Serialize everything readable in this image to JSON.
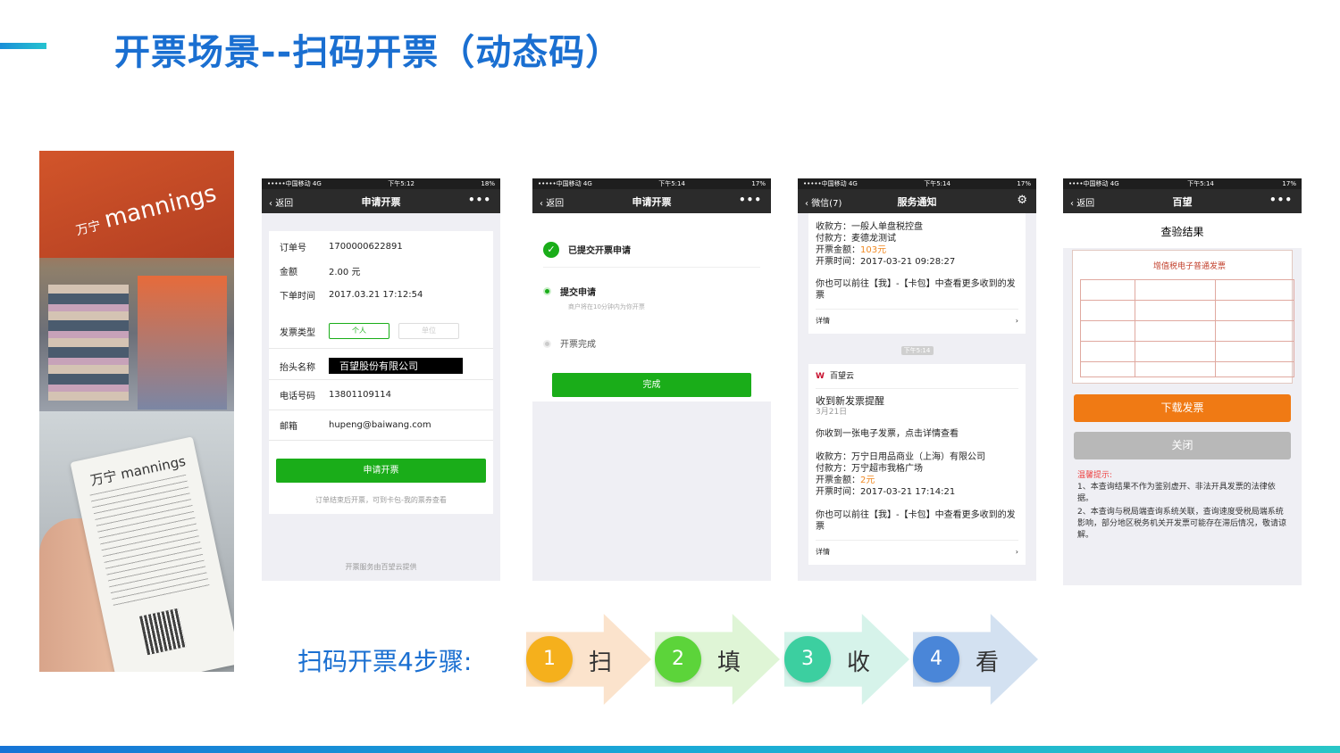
{
  "slide": {
    "title": "开票场景--扫码开票（动态码）",
    "steps_label": "扫码开票4步骤:",
    "steps": [
      {
        "num": "1",
        "word": "扫",
        "circle_color": "#f5b01c",
        "arrow_color": "#fbe3cc"
      },
      {
        "num": "2",
        "word": "填",
        "circle_color": "#5cd43a",
        "arrow_color": "#dff5d6"
      },
      {
        "num": "3",
        "word": "收",
        "circle_color": "#3ccfa0",
        "arrow_color": "#d6f3ea"
      },
      {
        "num": "4",
        "word": "看",
        "circle_color": "#4a86d8",
        "arrow_color": "#d3e1f1"
      }
    ]
  },
  "photos": {
    "store_brand": "mannings",
    "store_brand_cn": "万宁",
    "receipt_brand": "万宁 mannings"
  },
  "screen1": {
    "status": {
      "carrier": "•••••中国移动  4G",
      "time": "下午5:12",
      "battery": "18%"
    },
    "nav": {
      "back": "返回",
      "title": "申请开票",
      "more": "•••"
    },
    "order_label": "订单号",
    "order_value": "1700000622891",
    "amount_label": "金额",
    "amount_value": "2.00 元",
    "time_label": "下单时间",
    "time_value": "2017.03.21 17:12:54",
    "type_label": "发票类型",
    "type_personal": "个人",
    "type_company": "单位",
    "header_label": "抬头名称",
    "header_value": "百望股份有限公司",
    "phone_label": "电话号码",
    "phone_value": "13801109114",
    "email_label": "邮箱",
    "email_value": "hupeng@baiwang.com",
    "submit": "申请开票",
    "hint": "订单结束后开票，可到卡包-我的票券查看",
    "footer": "开票服务由百望云提供"
  },
  "screen2": {
    "status": {
      "carrier": "•••••中国移动  4G",
      "time": "下午5:14",
      "battery": "17%"
    },
    "nav": {
      "back": "返回",
      "title": "申请开票",
      "more": "•••"
    },
    "submitted": "已提交开票申请",
    "step1": "提交申请",
    "step1_hint": "商户将在10分钟内为你开票",
    "step2": "开票完成",
    "done": "完成"
  },
  "screen3": {
    "status": {
      "carrier": "•••••中国移动  4G",
      "time": "下午5:14",
      "battery": "17%"
    },
    "nav": {
      "back": "微信(7)",
      "title": "服务通知"
    },
    "msg1": {
      "payee": "收款方：一般人单盘税控盘",
      "payer": "付款方：麦德龙测试",
      "amount_prefix": "开票金额：",
      "amount": "103元",
      "time": "开票时间：2017-03-21 09:28:27",
      "note": "你也可以前往【我】-【卡包】中查看更多收到的发票",
      "detail": "详情"
    },
    "time_chip": "下午5:14",
    "msg2": {
      "sender": "百望云",
      "title": "收到新发票提醒",
      "date": "3月21日",
      "body": "你收到一张电子发票，点击详情查看",
      "payee": "收款方：万宁日用品商业（上海）有限公司",
      "payer": "付款方：万宁超市我格广场",
      "amount_prefix": "开票金额：",
      "amount": "2元",
      "time": "开票时间：2017-03-21 17:14:21",
      "note": "你也可以前往【我】-【卡包】中查看更多收到的发票",
      "detail": "详情"
    }
  },
  "screen4": {
    "status": {
      "carrier": "••••中国移动  4G",
      "time": "下午5:14",
      "battery": "17%"
    },
    "nav": {
      "back": "返回",
      "title": "百望",
      "more": "•••"
    },
    "result_title": "查验结果",
    "invoice_title": "增值税电子普通发票",
    "download": "下载发票",
    "close": "关闭",
    "warn_title": "温馨提示:",
    "warn1": "1、本查询结果不作为鉴别虚开、非法开具发票的法律依据。",
    "warn2": "2、本查询与税局端查询系统关联，查询速度受税局端系统影响，部分地区税务机关开发票可能存在滞后情况，敬请谅解。"
  }
}
